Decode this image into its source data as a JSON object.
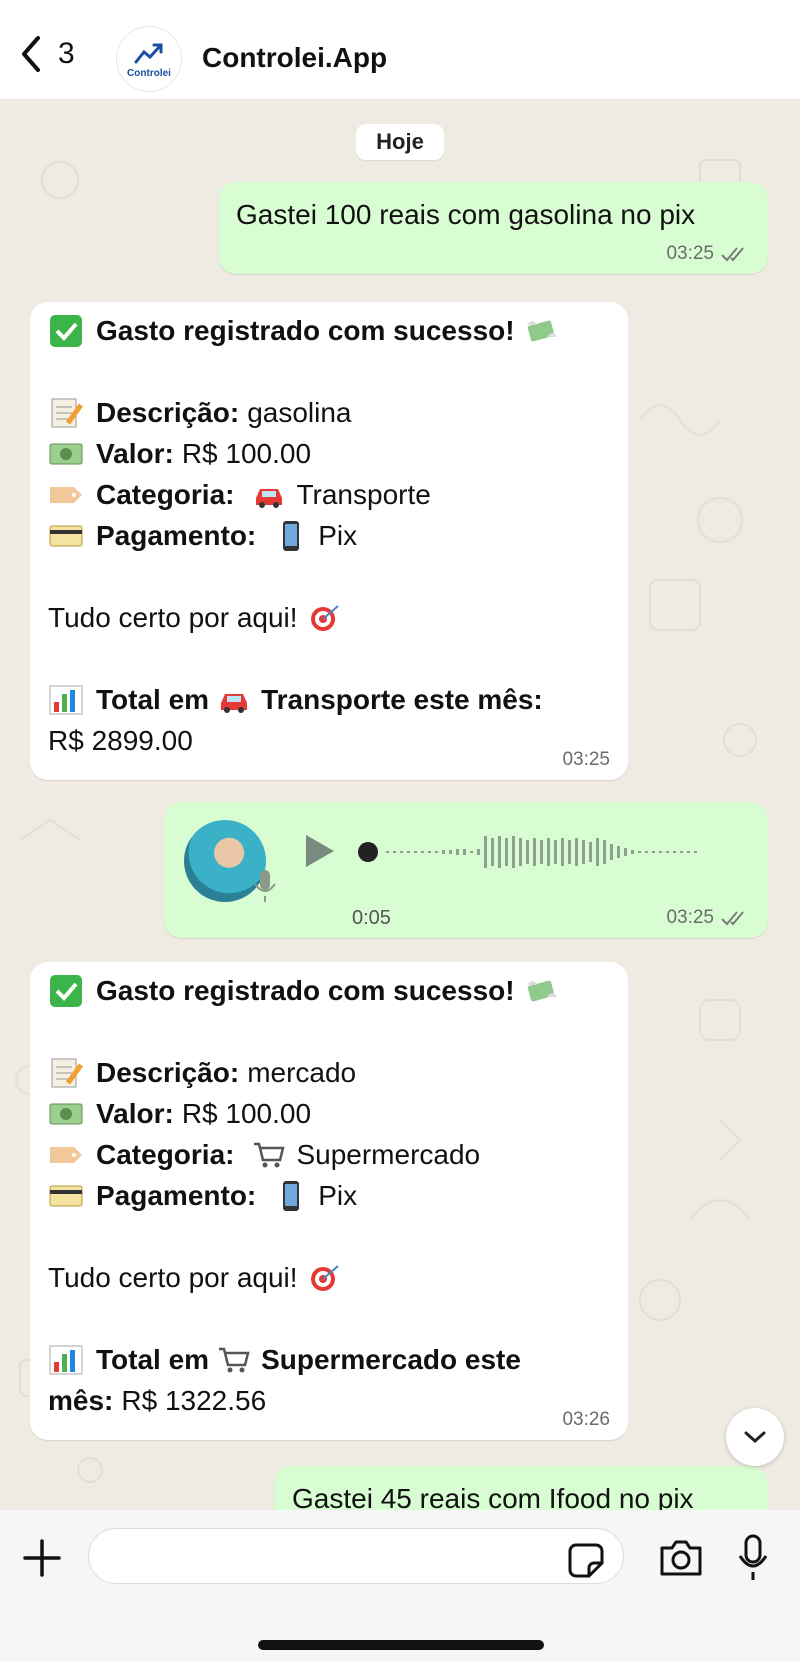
{
  "header": {
    "back_count": "3",
    "logo_text": "Controlei",
    "contact_name": "Controlei.App"
  },
  "chat": {
    "date_label": "Hoje",
    "messages": [
      {
        "direction": "out",
        "text": "Gastei 100 reais com gasolina no pix",
        "time": "03:25"
      },
      {
        "direction": "in",
        "title": "Gasto registrado com sucesso!",
        "desc_label": "Descrição:",
        "desc_value": "gasolina",
        "valor_label": "Valor:",
        "valor_value": "R$ 100.00",
        "cat_label": "Categoria:",
        "cat_value": "Transporte",
        "pag_label": "Pagamento:",
        "pag_value": "Pix",
        "ok_text": "Tudo certo por aqui!",
        "total_label_1": "Total em",
        "total_label_2": "Transporte este mês:",
        "total_value": "R$ 2899.00",
        "time": "03:25"
      },
      {
        "direction": "out",
        "type": "audio",
        "duration": "0:05",
        "time": "03:25"
      },
      {
        "direction": "in",
        "title": "Gasto registrado com sucesso!",
        "desc_label": "Descrição:",
        "desc_value": "mercado",
        "valor_label": "Valor:",
        "valor_value": "R$ 100.00",
        "cat_label": "Categoria:",
        "cat_value": "Supermercado",
        "pag_label": "Pagamento:",
        "pag_value": "Pix",
        "ok_text": "Tudo certo por aqui!",
        "total_label_1": "Total em",
        "total_label_2": "Supermercado este",
        "total_label_3": "mês:",
        "total_value": "R$ 1322.56",
        "time": "03:26"
      },
      {
        "direction": "out",
        "text": "Gastei 45 reais com Ifood no pix"
      }
    ]
  },
  "composer": {
    "placeholder": ""
  },
  "icons": {
    "back": "chevron-left-icon",
    "read_receipt": "double-check-icon",
    "play": "play-icon",
    "mic": "microphone-icon",
    "camera": "camera-icon",
    "sticker": "sticker-icon",
    "plus": "plus-icon",
    "scroll": "chevron-down-icon"
  },
  "colors": {
    "outgoing_bubble": "#d9fdd3",
    "incoming_bubble": "#ffffff",
    "chat_background": "#efeae2"
  }
}
